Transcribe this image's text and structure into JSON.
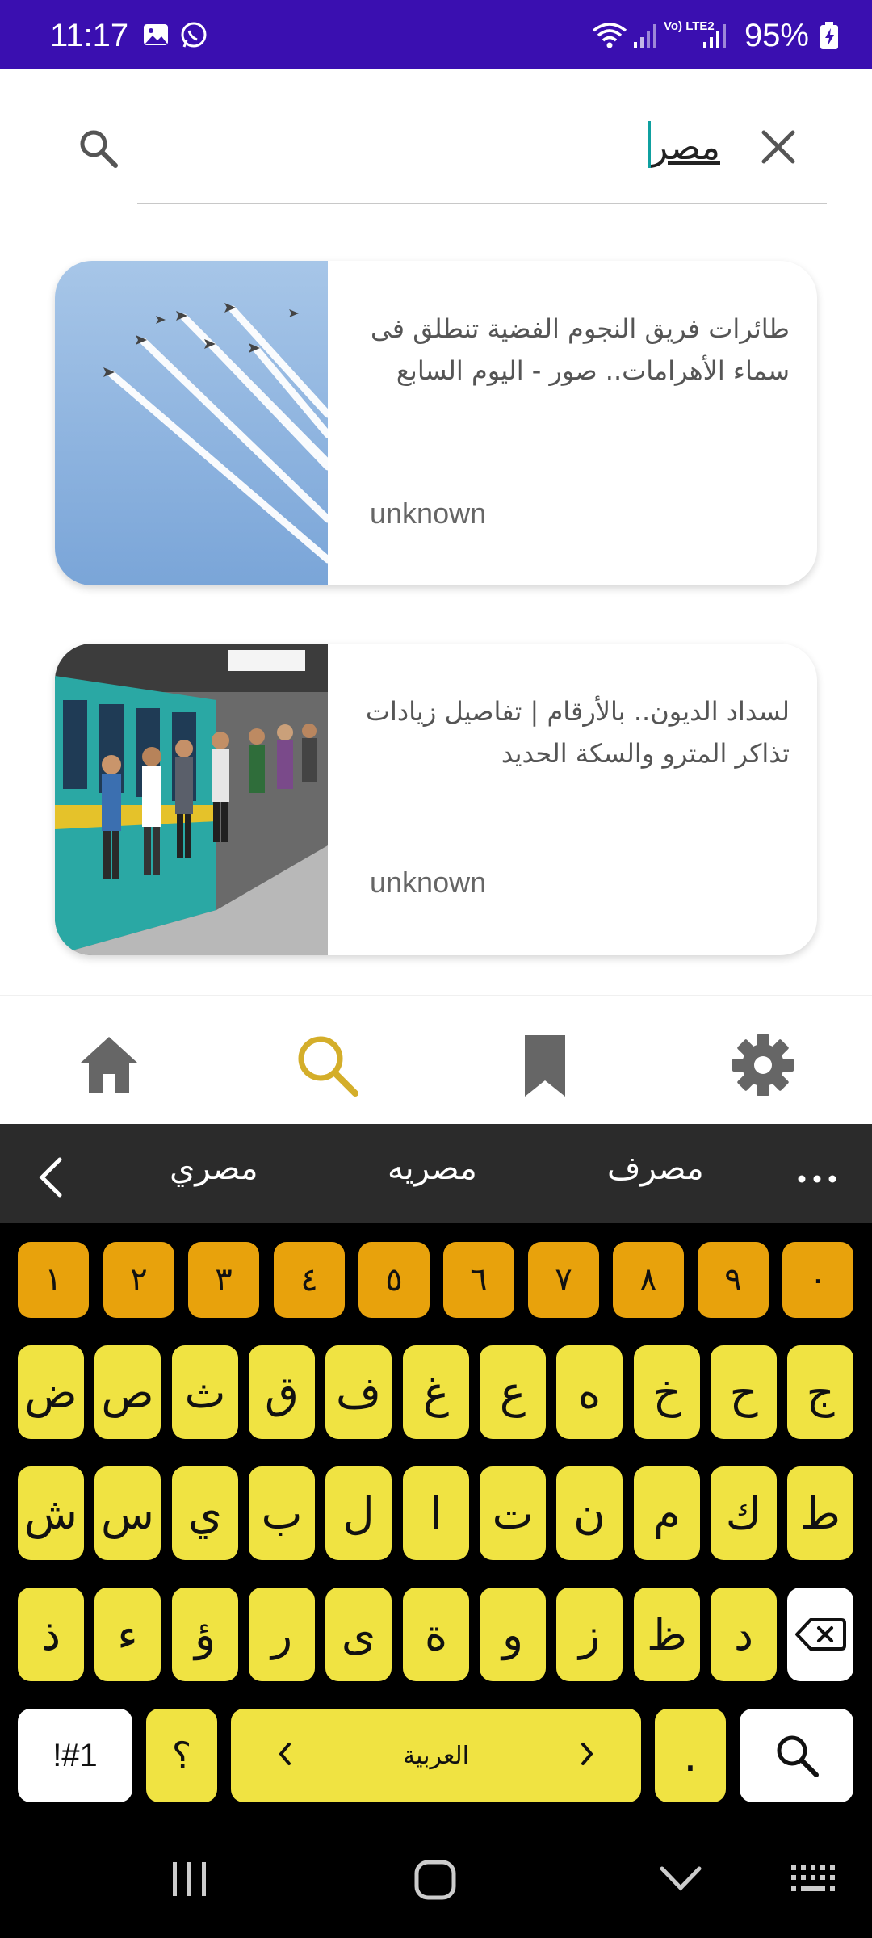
{
  "status_bar": {
    "time": "11:17",
    "battery": "95%",
    "icons": [
      "gallery-icon",
      "whatsapp-icon",
      "wifi-icon",
      "signal-icon",
      "volte-icon",
      "signal-icon",
      "battery-charging-icon"
    ],
    "volte_label": "Vo) LTE2"
  },
  "search": {
    "query": "مصر",
    "search_icon": "search-icon",
    "clear_icon": "close-icon"
  },
  "results": [
    {
      "title": "طائرات فريق النجوم الفضية تنطلق فى سماء الأهرامات.. صور - اليوم السابع",
      "source": "unknown",
      "image": "jets-sky-image"
    },
    {
      "title": "لسداد الديون.. بالأرقام | تفاصيل زيادات تذاكر المترو والسكة الحديد",
      "source": "unknown",
      "image": "metro-platform-image"
    }
  ],
  "bottom_nav": [
    {
      "name": "home-icon",
      "active": false
    },
    {
      "name": "search-icon",
      "active": true
    },
    {
      "name": "bookmark-icon",
      "active": false
    },
    {
      "name": "gear-icon",
      "active": false
    }
  ],
  "colors": {
    "status_bar": "#3a0fb0",
    "active_nav": "#d4ae2a",
    "inactive_nav": "#666666",
    "key_number": "#e8a20c",
    "key_letter": "#f0e342"
  },
  "keyboard": {
    "suggestions": [
      "مصري",
      "مصريه",
      "مصرف"
    ],
    "number_row": [
      "١",
      "٢",
      "٣",
      "٤",
      "٥",
      "٦",
      "٧",
      "٨",
      "٩",
      "٠"
    ],
    "row1": [
      "ض",
      "ص",
      "ث",
      "ق",
      "ف",
      "غ",
      "ع",
      "ه",
      "خ",
      "ح",
      "ج"
    ],
    "row2": [
      "ش",
      "س",
      "ي",
      "ب",
      "ل",
      "ا",
      "ت",
      "ن",
      "م",
      "ك",
      "ط"
    ],
    "row3": [
      "ذ",
      "ء",
      "ؤ",
      "ر",
      "ى",
      "ة",
      "و",
      "ز",
      "ظ",
      "د"
    ],
    "symbols_label": "!#1",
    "question_label": "؟",
    "space_label": "العربية",
    "period_label": "."
  }
}
